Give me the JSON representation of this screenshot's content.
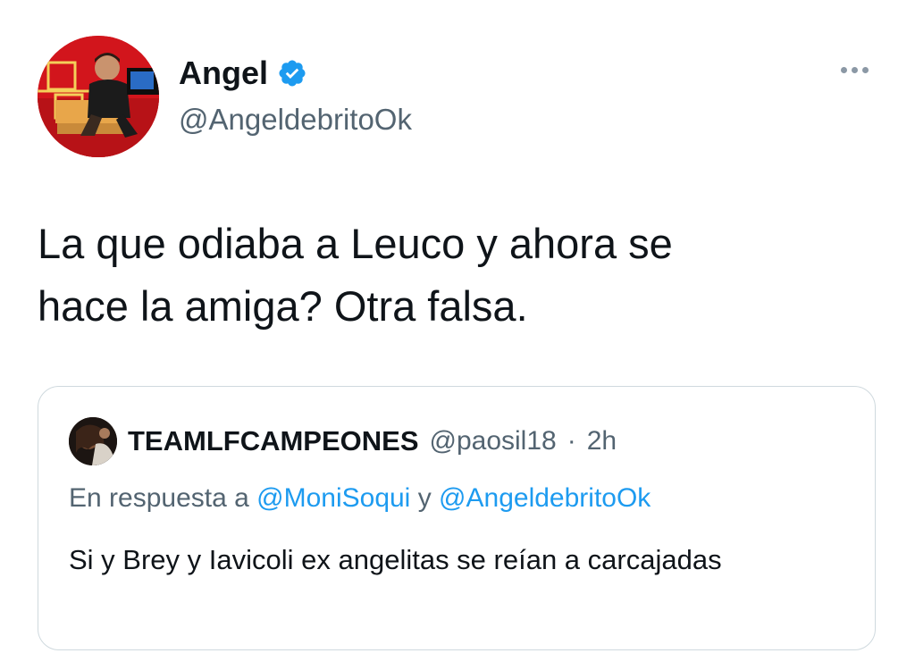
{
  "tweet": {
    "author": {
      "display_name": "Angel",
      "handle": "@AngeldebritoOk",
      "verified": true,
      "avatar_icon": "profile-photo"
    },
    "more_icon": "more-horizontal-icon",
    "text": "La que odiaba a Leuco y ahora se\nhace la amiga? Otra falsa."
  },
  "quoted_tweet": {
    "author": {
      "display_name": "TEAMLFCAMPEONES",
      "handle": "@paosil18",
      "avatar_icon": "profile-photo"
    },
    "separator": "·",
    "time": "2h",
    "reply_prefix": "En respuesta a",
    "reply_mention_1": "@MoniSoqui",
    "reply_joiner": "y",
    "reply_mention_2": "@AngeldebritoOk",
    "text": "Si y Brey y Iavicoli ex angelitas se reían a carcajadas"
  },
  "colors": {
    "text_primary": "#0f1419",
    "text_secondary": "#536471",
    "accent": "#1d9bf0",
    "border": "#cfd9de"
  }
}
